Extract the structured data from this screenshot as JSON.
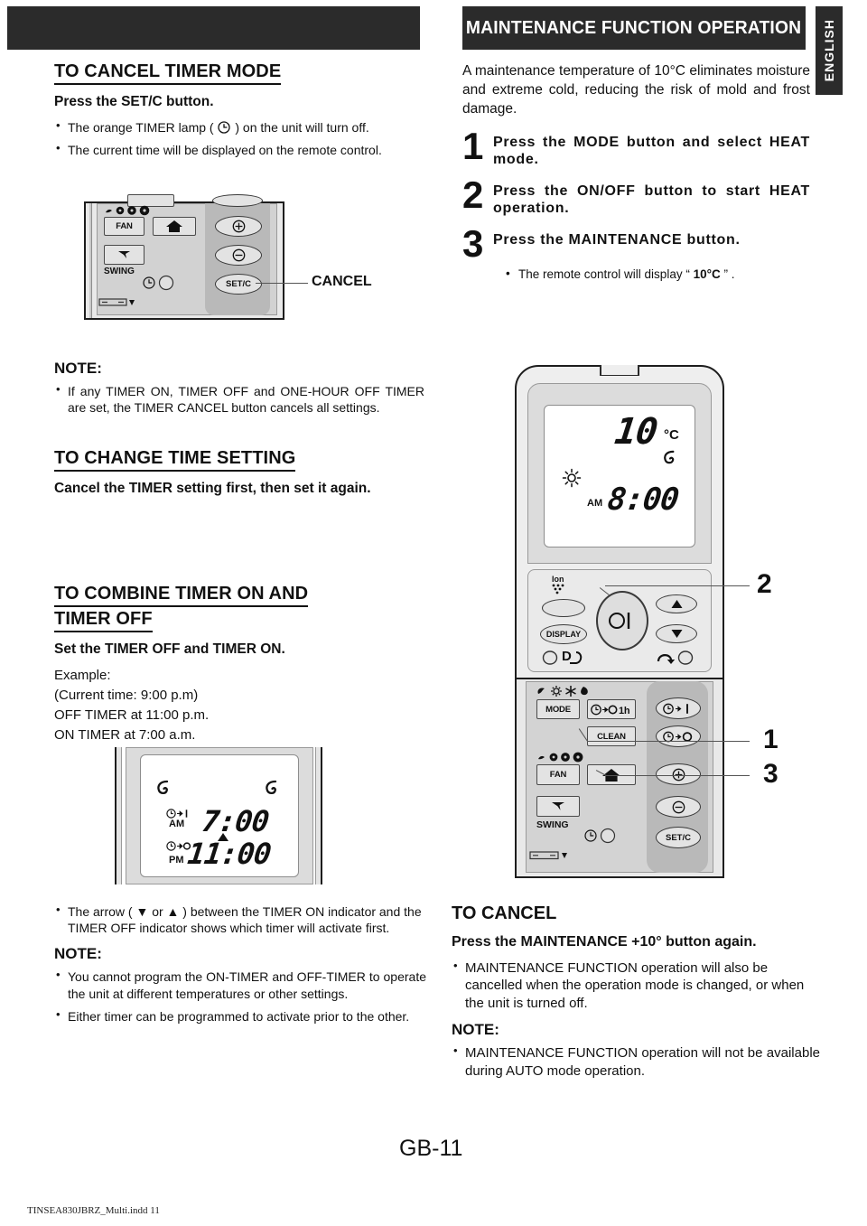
{
  "page": {
    "page_number": "GB-11",
    "file_note": "TINSEA830JBRZ_Multi.indd   11",
    "language_tab": "ENGLISH"
  },
  "banners": {
    "left_title": "",
    "right_title": "MAINTENANCE FUNCTION OPERATION"
  },
  "left_column": {
    "section1": {
      "heading": "TO CANCEL TIMER MODE",
      "lead": "Press the SET/C button.",
      "bullets": [
        "The orange TIMER lamp (  ) on the unit will turn off.",
        "The current time will be displayed on the remote control."
      ],
      "bullet1_pre": "The orange TIMER lamp ( ",
      "bullet1_post": " ) on the unit will turn off.",
      "callout_label": "CANCEL",
      "note_heading": "NOTE:",
      "note_bullets": [
        "If any TIMER ON, TIMER OFF and ONE-HOUR OFF TIMER are set, the TIMER CANCEL button cancels all settings."
      ]
    },
    "section2": {
      "heading": "TO CHANGE TIME SETTING",
      "lead": "Cancel the TIMER setting first, then set it again."
    },
    "section3": {
      "heading_line1": "TO COMBINE TIMER ON AND",
      "heading_line2": "TIMER OFF",
      "lead": "Set the TIMER OFF and TIMER ON.",
      "example_lines": [
        "Example:",
        "(Current time: 9:00 p.m)",
        "OFF TIMER at 11:00 p.m.",
        "ON TIMER at 7:00 a.m."
      ],
      "lcd": {
        "timer_on_label": "AM",
        "timer_on_time": "7:00",
        "timer_off_label": "PM",
        "timer_off_time": "11:00"
      }
    },
    "section4": {
      "bullets_top": [
        "The arrow ( ▼ or ▲ ) between the TIMER ON indicator and the TIMER OFF indicator shows which timer will activate first."
      ],
      "note_heading": "NOTE:",
      "note_bullets": [
        "You cannot program the ON-TIMER and OFF-TIMER to operate the unit at different temperatures or other settings.",
        "Either timer can be programmed to activate prior to the other."
      ]
    }
  },
  "right_column": {
    "intro": "A maintenance temperature of 10°C eliminates moisture and extreme cold, reducing the risk of mold and frost damage.",
    "steps": [
      {
        "number": "1",
        "text": "Press the MODE button and select HEAT mode."
      },
      {
        "number": "2",
        "text": "Press the ON/OFF button to start HEAT operation."
      },
      {
        "number": "3",
        "text": "Press the MAINTENANCE button."
      }
    ],
    "substep": {
      "prefix": "The remote control will display “ ",
      "value": "10°C",
      "suffix": " ” ."
    },
    "lcd": {
      "temperature": "10",
      "unit": "°C",
      "am_label": "AM",
      "time": "8:00"
    },
    "callouts": [
      {
        "number": "2",
        "target": "on-off-button"
      },
      {
        "number": "1",
        "target": "mode-button"
      },
      {
        "number": "3",
        "target": "maintenance-button"
      }
    ],
    "section_cancel": {
      "heading": "TO CANCEL",
      "lead": "Press the MAINTENANCE +10° button again.",
      "bullets": [
        "MAINTENANCE FUNCTION operation will also be cancelled when the operation mode is changed, or when the unit is turned off."
      ],
      "note_heading": "NOTE:",
      "note_bullets": [
        "MAINTENANCE FUNCTION operation will not be available during AUTO mode operation."
      ]
    }
  },
  "remote_buttons": {
    "display": "DISPLAY",
    "mode": "MODE",
    "one_hour": "1h",
    "clean": "CLEAN",
    "fan": "FAN",
    "swing": "SWING",
    "set_c": "SET/C",
    "ion": "Ion"
  }
}
